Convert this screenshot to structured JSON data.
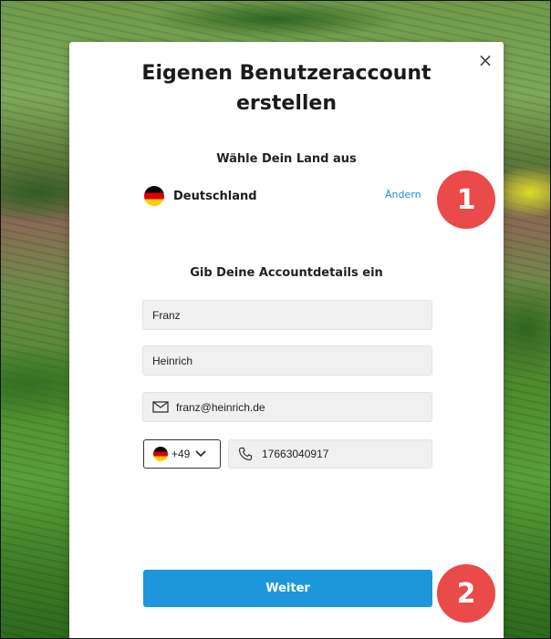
{
  "dialog": {
    "title": "Eigenen Benutzeraccount erstellen",
    "close_icon": "×"
  },
  "country_section": {
    "heading": "Wähle Dein Land aus",
    "country_name": "Deutschland",
    "change_label": "Ändern"
  },
  "account_section": {
    "heading": "Gib Deine Accountdetails ein",
    "first_name": "Franz",
    "last_name": "Heinrich",
    "email": "franz@heinrich.de",
    "country_code": "+49",
    "phone": "17663040917"
  },
  "submit_label": "Weiter",
  "callouts": [
    "1",
    "2"
  ],
  "colors": {
    "accent": "#1e96dc",
    "callout": "#ea4a4a"
  },
  "icons": {
    "close": "close-icon",
    "email": "envelope-icon",
    "phone": "phone-icon",
    "dropdown": "chevron-down-icon",
    "flag": "germany-flag-icon"
  }
}
